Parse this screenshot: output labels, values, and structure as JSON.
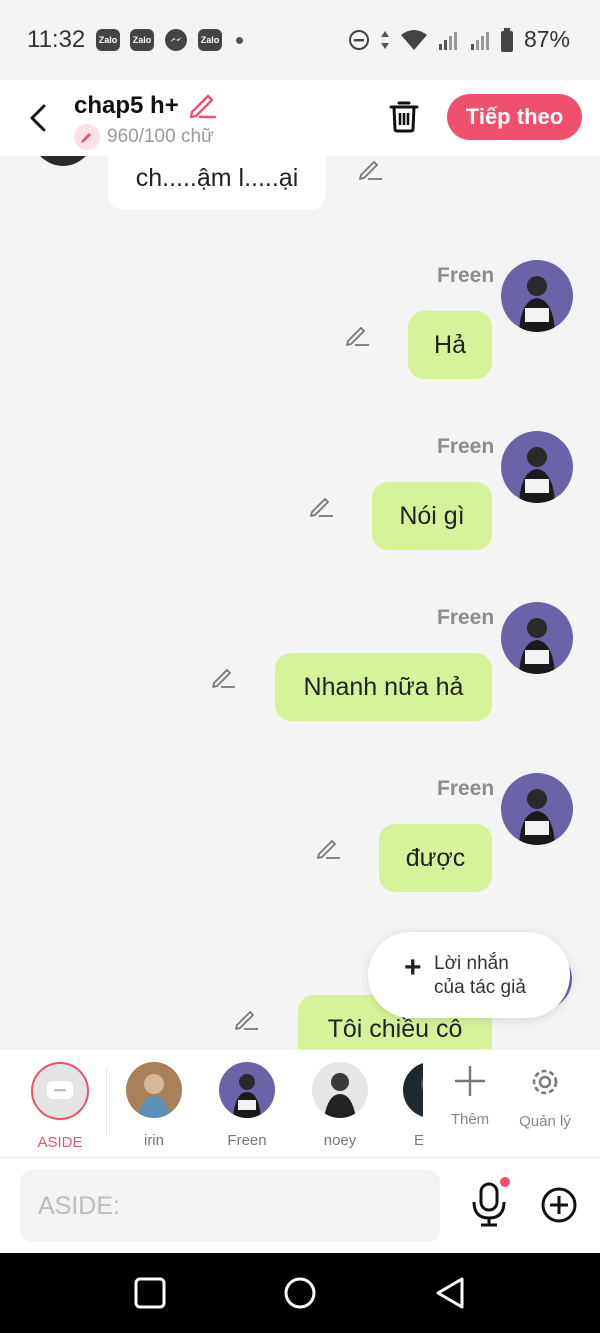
{
  "status_bar": {
    "time": "11:32",
    "notifications": [
      "Zalo",
      "Zalo",
      "messenger-icon",
      "Zalo"
    ],
    "battery": "87%"
  },
  "header": {
    "title": "chap5 h+",
    "subtitle": "960/100 chữ",
    "next_label": "Tiếp theo"
  },
  "messages": [
    {
      "side": "left",
      "text": "ch.....ậm l.....ại"
    },
    {
      "side": "right",
      "sender": "Freen",
      "text": "Hả"
    },
    {
      "side": "right",
      "sender": "Freen",
      "text": "Nói gì"
    },
    {
      "side": "right",
      "sender": "Freen",
      "text": "Nhanh nữa hả"
    },
    {
      "side": "right",
      "sender": "Freen",
      "text": "được"
    },
    {
      "side": "right",
      "text": "Tôi chiều cô"
    }
  ],
  "popup": {
    "line1": "Lời nhắn",
    "line2": "của tác giả"
  },
  "characters": [
    {
      "label": "ASIDE"
    },
    {
      "label": "irin"
    },
    {
      "label": "Freen"
    },
    {
      "label": "noey"
    },
    {
      "label": "E"
    }
  ],
  "tools": {
    "add_label": "Thêm",
    "manage_label": "Quản lý"
  },
  "input": {
    "placeholder": "ASIDE:"
  },
  "colors": {
    "accent": "#f0506b",
    "bubble_right": "#d6f39a",
    "bubble_left": "#ffffff"
  }
}
